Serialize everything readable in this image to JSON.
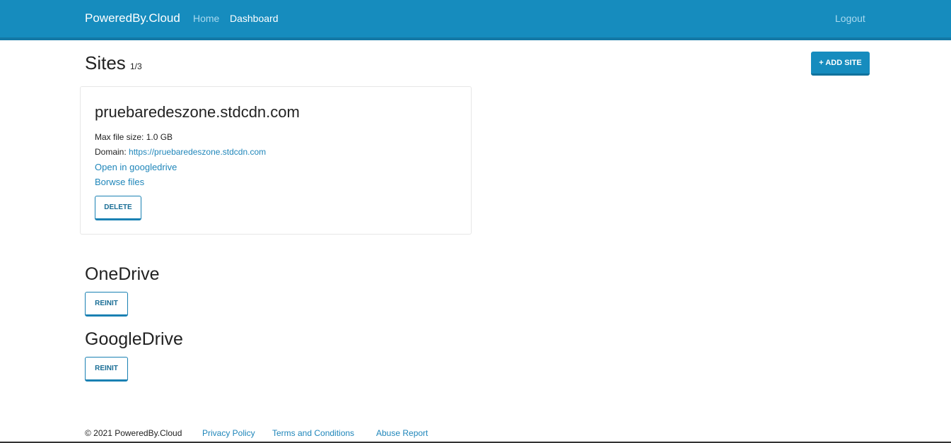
{
  "navbar": {
    "brand": "PoweredBy.Cloud",
    "home": "Home",
    "dashboard": "Dashboard",
    "logout": "Logout"
  },
  "sites": {
    "title": "Sites",
    "count": "1/3",
    "add_button": "+ ADD SITE",
    "items": [
      {
        "name": "pruebaredeszone.stdcdn.com",
        "max_file_label": "Max file size:",
        "max_file_value": "1.0 GB",
        "domain_label": "Domain:",
        "domain_value": "https://pruebaredeszone.stdcdn.com",
        "open_link": "Open in googledrive",
        "browse_link": "Borwse files",
        "delete_button": "DELETE"
      }
    ]
  },
  "onedrive": {
    "title": "OneDrive",
    "button": "REINIT"
  },
  "googledrive": {
    "title": "GoogleDrive",
    "button": "REINIT"
  },
  "footer": {
    "copyright": "© 2021 PoweredBy.Cloud",
    "privacy": "Privacy Policy",
    "terms": "Terms and Conditions",
    "abuse": "Abuse Report"
  },
  "colors": {
    "brand": "#168cbe",
    "link": "#1f86ba"
  }
}
